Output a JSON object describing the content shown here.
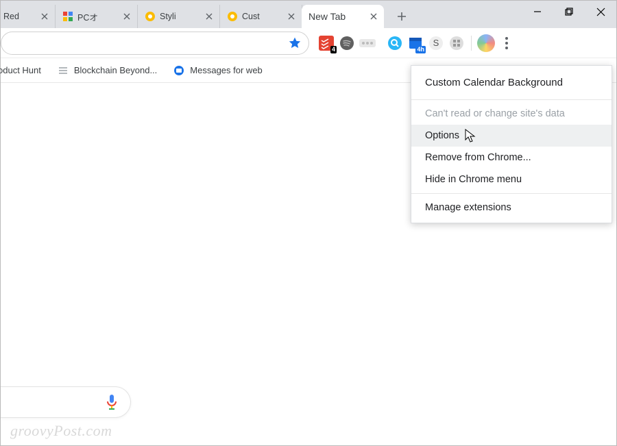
{
  "tabs": [
    {
      "label": "Red",
      "favicon_color": "#e53935"
    },
    {
      "label": "PCオ",
      "favicon_color": "#4285f4"
    },
    {
      "label": "Styli",
      "favicon_color": "#fbbc04"
    },
    {
      "label": "Cust",
      "favicon_color": "#fbbc04"
    },
    {
      "label": "New Tab",
      "favicon_color": ""
    }
  ],
  "active_tab_index": 4,
  "extensions": [
    {
      "name": "todoist",
      "color": "#e44332",
      "badge": "4"
    },
    {
      "name": "spotify",
      "color": "#555"
    },
    {
      "name": "translate",
      "color": "#c8c8c8"
    },
    {
      "name": "search-blue",
      "color": "#29b6f6"
    },
    {
      "name": "calendar",
      "color": "#1a73e8",
      "badge": "4h",
      "badge_style": "blue"
    },
    {
      "name": "skype",
      "color": "#888"
    },
    {
      "name": "qr",
      "color": "#bbb"
    }
  ],
  "bookmarks": [
    {
      "label": "oduct Hunt",
      "icon": "red-dot"
    },
    {
      "label": "Blockchain Beyond...",
      "icon": "gray-lines"
    },
    {
      "label": "Messages for web",
      "icon": "blue-circle"
    }
  ],
  "menu": {
    "title": "Custom Calendar Background",
    "items": [
      {
        "label": "Can't read or change site's data",
        "disabled": true
      },
      {
        "label": "Options",
        "hover": true
      },
      {
        "label": "Remove from Chrome...",
        "disabled": false
      },
      {
        "label": "Hide in Chrome menu",
        "disabled": false
      }
    ],
    "footer": "Manage extensions"
  },
  "watermark": "groovyPost.com",
  "win_controls": {
    "minimize": "−",
    "maximize": "⧉",
    "close": "×"
  }
}
